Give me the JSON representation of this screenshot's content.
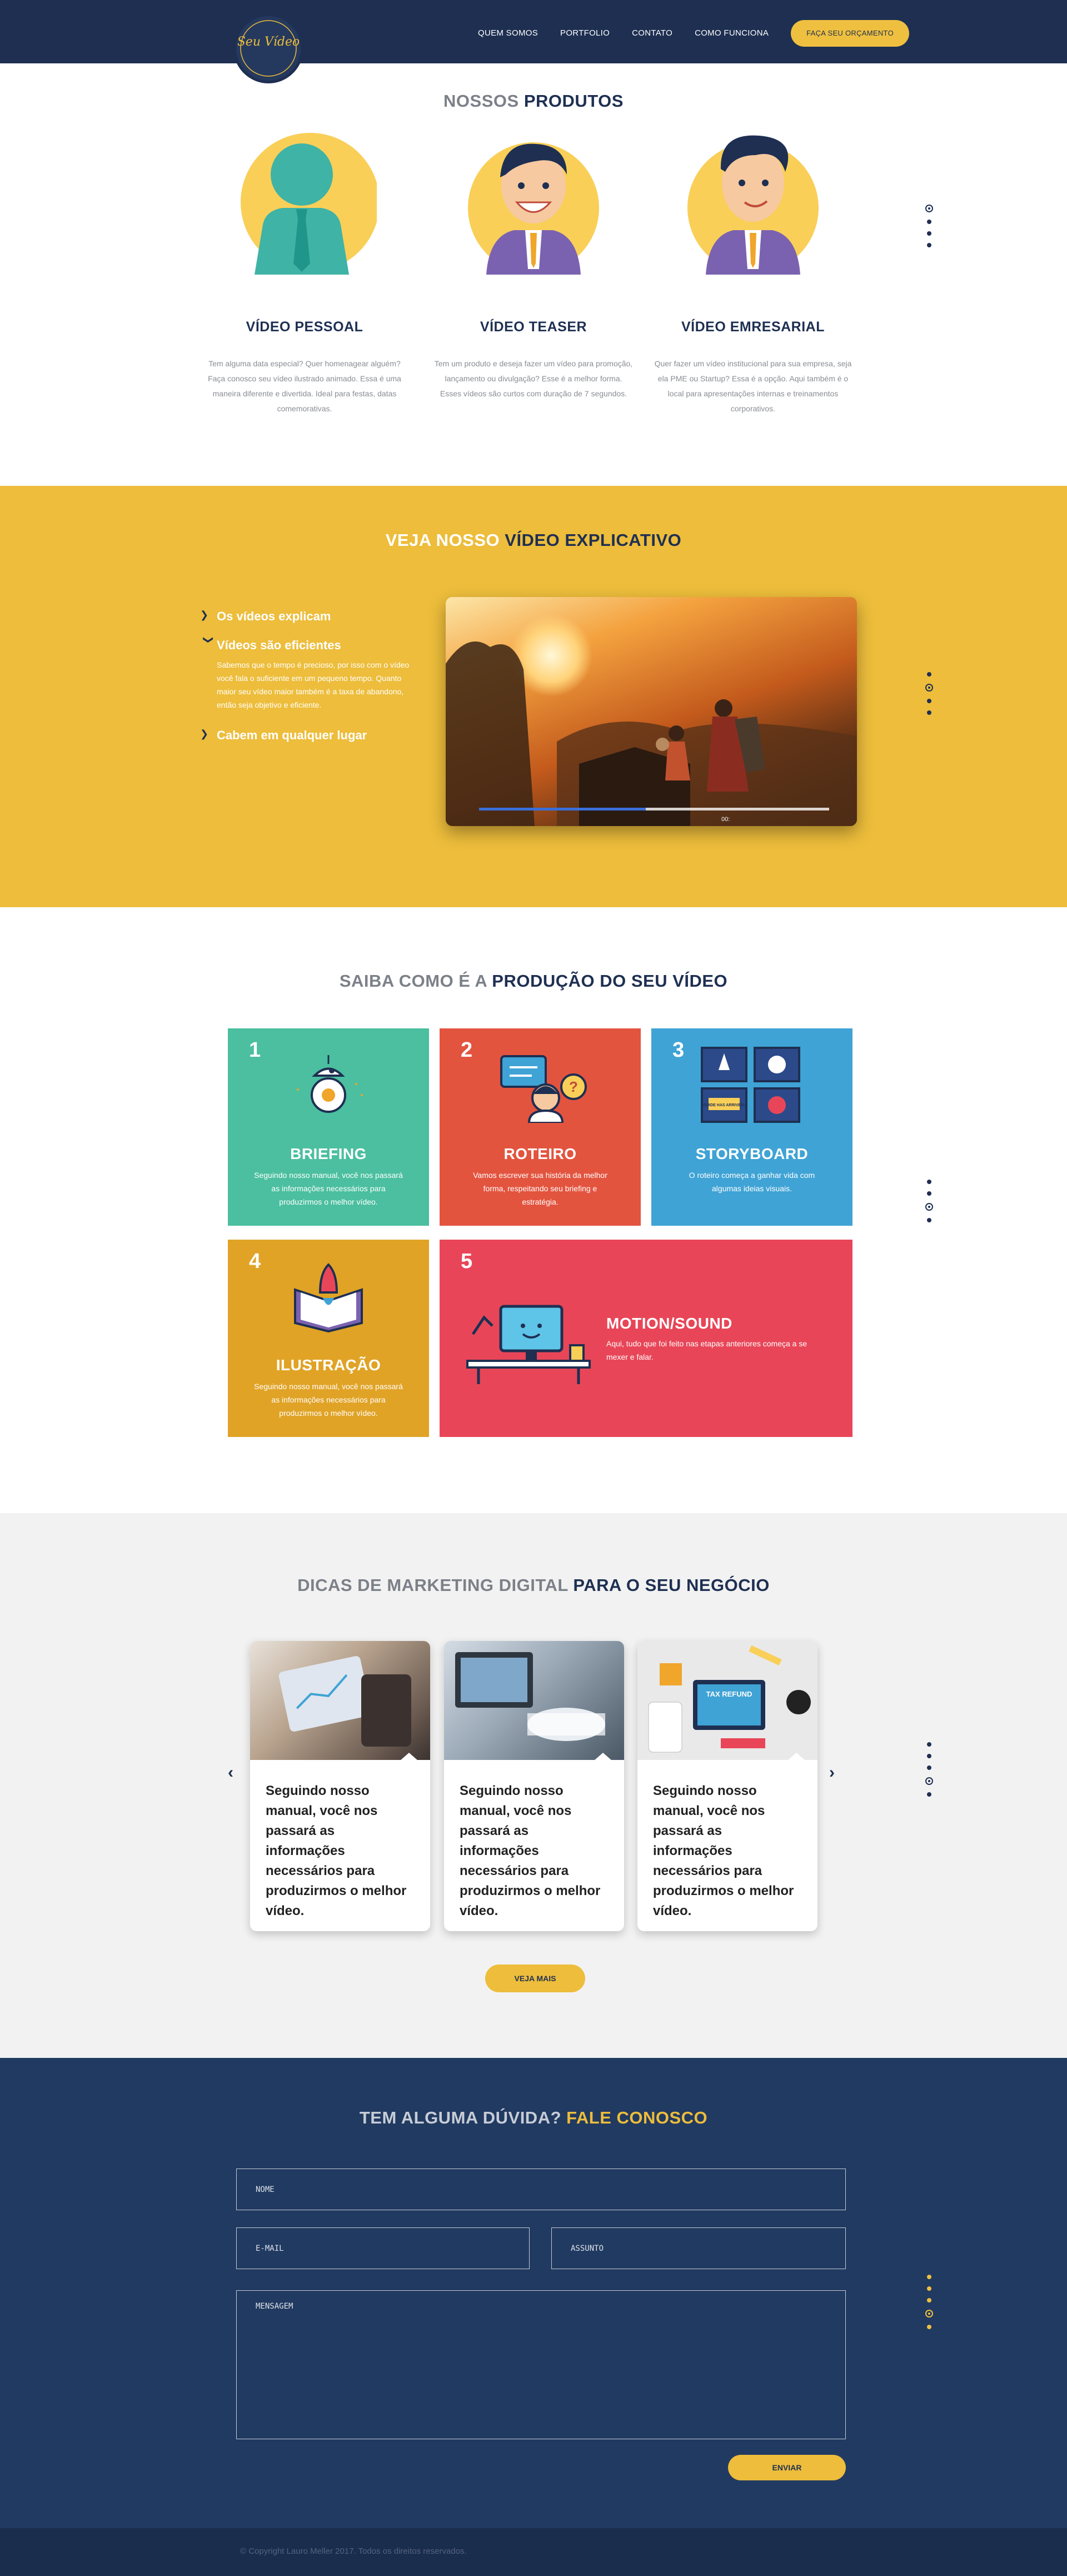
{
  "header": {
    "logo_text": "Seu Vídeo",
    "nav": [
      "QUEM SOMOS",
      "PORTFOLIO",
      "CONTATO",
      "COMO FUNCIONA"
    ],
    "cta": "FAÇA SEU ORÇAMENTO"
  },
  "produtos": {
    "title_light": "NOSSOS ",
    "title_bold": "PRODUTOS",
    "items": [
      {
        "title": "VÍDEO PESSOAL",
        "text": "Tem alguma data especial? Quer homenagear alguém? Faça conosco seu vídeo ilustrado animado. Essa é uma maneira diferente e divertida. Ideal para festas, datas comemorativas."
      },
      {
        "title": "VÍDEO TEASER",
        "text": "Tem um produto e deseja fazer um vídeo para promoção, lançamento ou divulgação? Esse é a melhor forma. Esses vídeos são curtos com duração de 7 segundos."
      },
      {
        "title": "VÍDEO EMRESARIAL",
        "text": "Quer fazer um vídeo institucional para sua empresa, seja ela PME ou Startup? Essa é a opção. Aqui também é o local para apresentações internas e treinamentos corporativos."
      }
    ]
  },
  "video": {
    "title_light": "VEJA NOSSO ",
    "title_bold": "VÍDEO EXPLICATIVO",
    "items": [
      {
        "label": "Os vídeos explicam"
      },
      {
        "label": "Vídeos são eficientes",
        "desc": "Sabemos que o tempo é precioso, por isso com o vídeo você fala o suficiente em um pequeno tempo. Quanto maior seu vídeo maior também é a taxa de abandono, então seja objetivo e eficiente."
      },
      {
        "label": "Cabem em qualquer lugar"
      }
    ],
    "time": "00:"
  },
  "producao": {
    "title_light": "SAIBA COMO É A ",
    "title_bold": "PRODUÇÃO DO SEU VÍDEO",
    "cards": [
      {
        "num": "1",
        "title": "BRIEFING",
        "text": "Seguindo nosso manual, você nos passará as informações necessários para produzirmos o melhor vídeo.",
        "color": "#4bbf9f"
      },
      {
        "num": "2",
        "title": "ROTEIRO",
        "text": "Vamos escrever sua história da melhor forma, respeitando seu briefing e estratégia.",
        "color": "#e3543f"
      },
      {
        "num": "3",
        "title": "STORYBOARD",
        "text": "O roteiro começa a ganhar vida com algumas ideias visuais.",
        "color": "#3fa3d5"
      },
      {
        "num": "4",
        "title": "ILUSTRAÇÃO",
        "text": "Seguindo nosso manual, você nos passará as informações necessários para produzirmos o melhor vídeo.",
        "color": "#e0a326"
      },
      {
        "num": "5",
        "title": "MOTION/SOUND",
        "text": "Aqui, tudo que foi feito nas etapas anteriores começa a se mexer e falar.",
        "color": "#e84658"
      }
    ],
    "storyboard_sign": "GUIDE HAS ARRIVED!"
  },
  "dicas": {
    "title_light": "DICAS DE MARKETING DIGITAL ",
    "title_bold": "PARA O SEU NEGÓCIO",
    "posts": [
      {
        "text": "Seguindo nosso manual, você nos passará as informações necessários para produzirmos o melhor vídeo."
      },
      {
        "text": "Seguindo nosso manual, você nos passará as informações necessários para produzirmos o melhor vídeo."
      },
      {
        "text": "Seguindo nosso manual, você nos passará as informações necessários para produzirmos o melhor vídeo."
      }
    ],
    "tax_label": "TAX REFUND",
    "more": "VEJA MAIS"
  },
  "contato": {
    "title_light": "TEM ALGUMA DÚVIDA? ",
    "title_bold": "FALE CONOSCO",
    "name_ph": "NOME",
    "email_ph": "E-MAIL",
    "subject_ph": "ASSUNTO",
    "message_ph": "MENSAGEM",
    "send": "ENVIAR"
  },
  "footer": {
    "copyright": "© Copyright Lauro Meller 2017. Todos os direitos reservados."
  },
  "colors": {
    "navy": "#1e2f52",
    "yellow": "#edbd3b",
    "contact_bg": "#213a61"
  }
}
